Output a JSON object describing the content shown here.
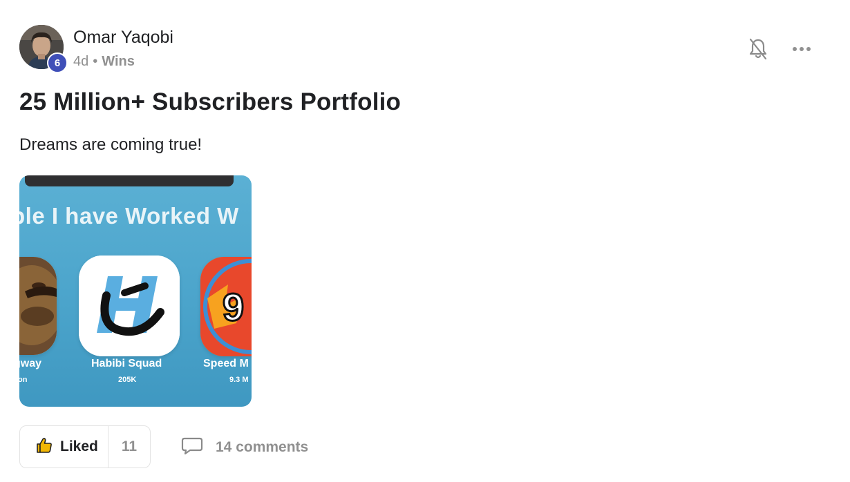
{
  "author": {
    "name": "Omar Yaqobi",
    "level": "6",
    "time_ago": "4d",
    "separator": "•",
    "category": "Wins"
  },
  "post": {
    "title": "25 Million+ Subscribers Portfolio",
    "body": "Dreams are coming true!"
  },
  "image": {
    "heading": "ple I have Worked W",
    "tiles": [
      {
        "label": "gway",
        "sub": "on",
        "icon": "sloth-avatar-icon"
      },
      {
        "label": "Habibi Squad",
        "sub": "205K",
        "icon": "habibi-squad-logo-icon"
      },
      {
        "label": "Speed M",
        "sub": "9.3 M",
        "icon": "speed-logo-icon"
      }
    ]
  },
  "actions": {
    "like_label": "Liked",
    "like_count": "11",
    "comments_label": "14 comments"
  },
  "icons": {
    "notification": "bell-off-icon",
    "more": "more-options-icon",
    "like": "thumbs-up-icon",
    "comment": "comment-icon"
  },
  "colors": {
    "level_badge": "#3f4fb8",
    "muted_text": "#909090",
    "like_icon": "#f2b705",
    "image_bg": "#4ba4cb"
  }
}
